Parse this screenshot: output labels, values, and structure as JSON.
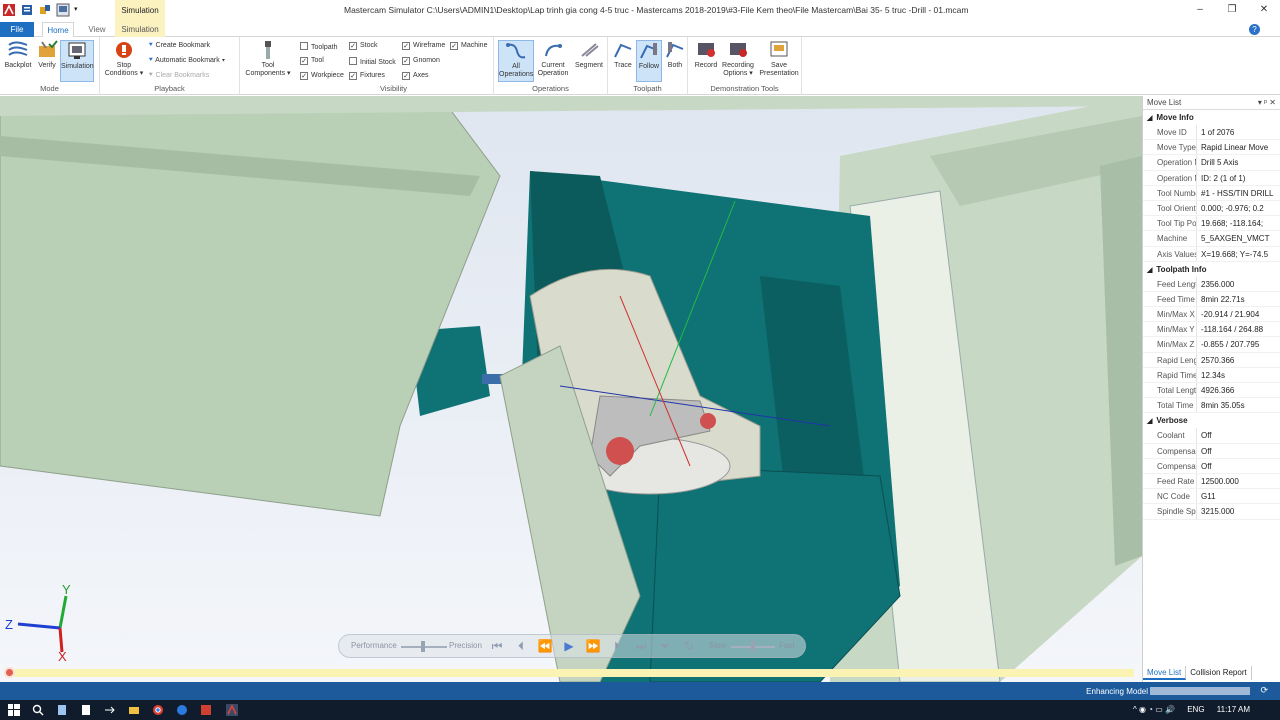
{
  "window": {
    "title": "Mastercam Simulator  C:\\Users\\ADMIN1\\Desktop\\Lap trinh gia cong 4-5 truc - Mastercams 2018-2019\\#3-File Kem theo\\File Mastercam\\Bai 35- 5 truc -Drill - 01.mcam",
    "context_tab": "Simulation",
    "controls": [
      "–",
      "❐",
      "✕"
    ]
  },
  "tabs": {
    "file": "File",
    "home": "Home",
    "view": "View",
    "simulation": "Simulation",
    "help": "?"
  },
  "ribbon": {
    "mode": {
      "label": "Mode",
      "backplot": "Backplot",
      "verify": "Verify",
      "simulation": "Simulation"
    },
    "playback": {
      "label": "Playback",
      "stop_conditions_1": "Stop",
      "stop_conditions_2": "Conditions ▾",
      "create_bookmark": "Create Bookmark",
      "automatic_bookmark": "Automatic Bookmark  ▾",
      "clear_bookmarks": "Clear Bookmarks"
    },
    "tool_components": {
      "line1": "Tool",
      "line2": "Components ▾"
    },
    "visibility": {
      "label": "Visibility",
      "toolpath": "Toolpath",
      "tool": "Tool",
      "workpiece": "Workpiece",
      "stock": "Stock",
      "initial_stock": "Initial Stock",
      "fixtures": "Fixtures",
      "wireframe": "Wireframe",
      "gnomon": "Gnomon",
      "axes": "Axes",
      "machine": "Machine"
    },
    "operations": {
      "label": "Operations",
      "all_1": "All",
      "all_2": "Operations",
      "current_1": "Current",
      "current_2": "Operation",
      "segment": "Segment"
    },
    "toolpath": {
      "label": "Toolpath",
      "trace": "Trace",
      "follow": "Follow",
      "both": "Both"
    },
    "demo": {
      "label": "Demonstration Tools",
      "record": "Record",
      "recording_1": "Recording",
      "recording_2": "Options ▾",
      "save_1": "Save",
      "save_2": "Presentation"
    }
  },
  "move_list": {
    "title": "Move List",
    "pin": "▾  ᵖ  ✕",
    "sections": [
      {
        "name": "Move Info",
        "rows": [
          {
            "k": "Move ID",
            "v": "1 of 2076"
          },
          {
            "k": "Move Type",
            "v": "Rapid Linear Move"
          },
          {
            "k": "Operation Na",
            "v": "Drill 5 Axis"
          },
          {
            "k": "Operation Nu",
            "v": "ID: 2 (1 of 1)"
          },
          {
            "k": "Tool Number",
            "v": "#1 - HSS/TIN DRILL"
          },
          {
            "k": "Tool Orientati",
            "v": "0.000; -0.976; 0.2"
          },
          {
            "k": "Tool Tip Positi",
            "v": "19.668; -118.164;"
          },
          {
            "k": "Machine",
            "v": "5_5AXGEN_VMCT"
          },
          {
            "k": "Axis Values",
            "v": "X=19.668; Y=-74.5"
          }
        ]
      },
      {
        "name": "Toolpath Info",
        "rows": [
          {
            "k": "Feed Length",
            "v": "2356.000"
          },
          {
            "k": "Feed Time",
            "v": "8min 22.71s"
          },
          {
            "k": "Min/Max X",
            "v": "-20.914 / 21.904"
          },
          {
            "k": "Min/Max Y",
            "v": "-118.164 / 264.88"
          },
          {
            "k": "Min/Max Z",
            "v": "-0.855 / 207.795"
          },
          {
            "k": "Rapid Length",
            "v": "2570.366"
          },
          {
            "k": "Rapid Time",
            "v": "12.34s"
          },
          {
            "k": "Total Length",
            "v": "4926.366"
          },
          {
            "k": "Total Time",
            "v": "8min 35.05s"
          }
        ]
      },
      {
        "name": "Verbose",
        "rows": [
          {
            "k": "Coolant",
            "v": "Off"
          },
          {
            "k": "Compensation",
            "v": "Off"
          },
          {
            "k": "Compensation",
            "v": "Off"
          },
          {
            "k": "Feed Rate",
            "v": "12500.000"
          },
          {
            "k": "NC Code",
            "v": "G11"
          },
          {
            "k": "Spindle Speed",
            "v": "3215.000"
          }
        ]
      }
    ],
    "tabs": [
      "Move List",
      "Collision Report"
    ]
  },
  "sim_controls": {
    "performance": "Performance",
    "precision": "Precision",
    "slow": "Slow",
    "fast": "Fast"
  },
  "gnomon": {
    "y": "Y",
    "z": "Z",
    "x": "X"
  },
  "status": {
    "enhancing": "Enhancing Model",
    "enhancing_progress": 0.0
  },
  "taskbar": {
    "lang": "ENG",
    "time": "11:17 AM"
  },
  "colors": {
    "accent": "#1e6fc2",
    "machine_body": "#b9cfb6",
    "teal": "#0e6f73",
    "status_bar": "#1d5a9c"
  }
}
